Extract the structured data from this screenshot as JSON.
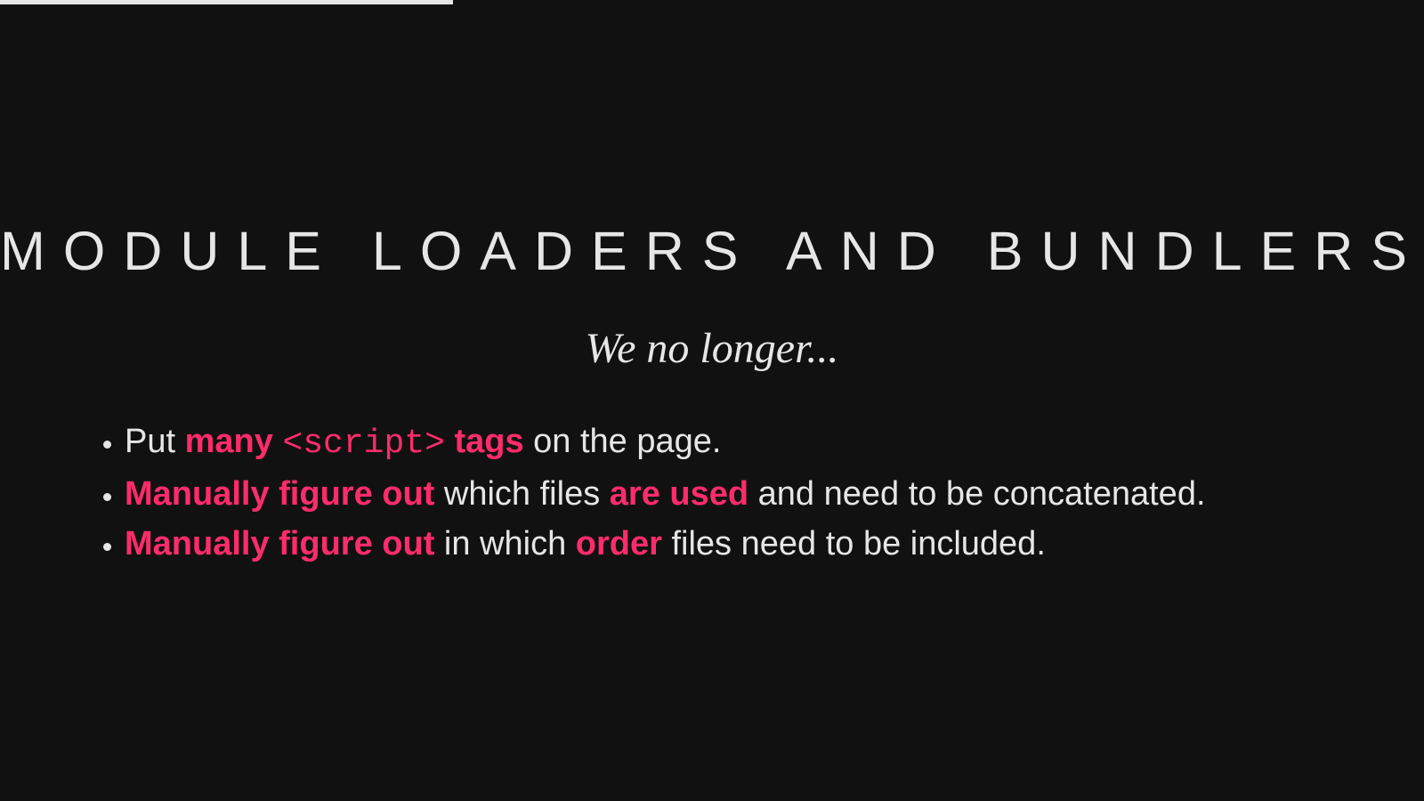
{
  "progress": {
    "fraction": 0.318
  },
  "title": "MODULE LOADERS AND BUNDLERS",
  "subtitle": "We no longer...",
  "bullets": [
    {
      "segments": [
        {
          "text": "Put ",
          "style": "plain"
        },
        {
          "text": "many",
          "style": "highlight"
        },
        {
          "text": " ",
          "style": "plain"
        },
        {
          "text": "<script>",
          "style": "code"
        },
        {
          "text": " ",
          "style": "plain"
        },
        {
          "text": "tags",
          "style": "highlight"
        },
        {
          "text": " on the page.",
          "style": "plain"
        }
      ]
    },
    {
      "segments": [
        {
          "text": "Manually figure out",
          "style": "highlight"
        },
        {
          "text": " which files ",
          "style": "plain"
        },
        {
          "text": "are used",
          "style": "highlight"
        },
        {
          "text": " and need to be concatenated.",
          "style": "plain"
        }
      ]
    },
    {
      "segments": [
        {
          "text": "Manually figure out",
          "style": "highlight"
        },
        {
          "text": " in which ",
          "style": "plain"
        },
        {
          "text": "order",
          "style": "highlight"
        },
        {
          "text": " files need to be included.",
          "style": "plain"
        }
      ]
    }
  ],
  "colors": {
    "background": "#111111",
    "text": "#e6e6e6",
    "accent": "#ff2c6b"
  }
}
